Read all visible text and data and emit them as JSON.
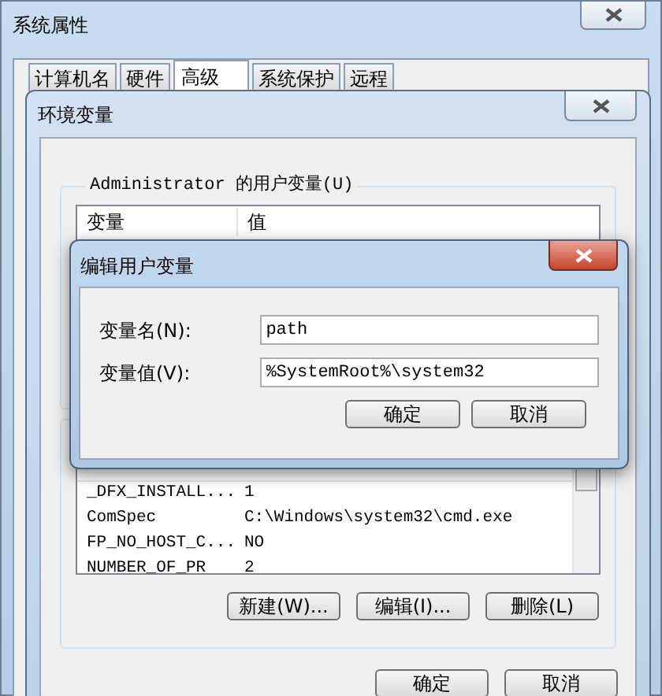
{
  "outer_window": {
    "title": "系统属性"
  },
  "tabs": [
    {
      "label": "计算机名",
      "selected": false
    },
    {
      "label": "硬件",
      "selected": false
    },
    {
      "label": "高级",
      "selected": true
    },
    {
      "label": "系统保护",
      "selected": false
    },
    {
      "label": "远程",
      "selected": false
    }
  ],
  "env_window": {
    "title": "环境变量",
    "user_group": "Administrator 的用户变量(U)",
    "user_columns": [
      "变量",
      "值"
    ],
    "system_rows": [
      {
        "name": "_DFX_INSTALL...",
        "value": "1"
      },
      {
        "name": "ComSpec",
        "value": "C:\\Windows\\system32\\cmd.exe"
      },
      {
        "name": "FP_NO_HOST_C...",
        "value": "NO"
      },
      {
        "name": "NUMBER_OF_PR",
        "value": "2"
      }
    ],
    "system_buttons": [
      "新建(W)...",
      "编辑(I)...",
      "删除(L)"
    ],
    "buttons": [
      "确定",
      "取消"
    ]
  },
  "edit_dialog": {
    "title": "编辑用户变量",
    "fields": [
      {
        "label": "变量名(N):",
        "value": "path"
      },
      {
        "label": "变量值(V):",
        "value": "%SystemRoot%\\system32"
      }
    ],
    "buttons": [
      "确定",
      "取消"
    ]
  }
}
